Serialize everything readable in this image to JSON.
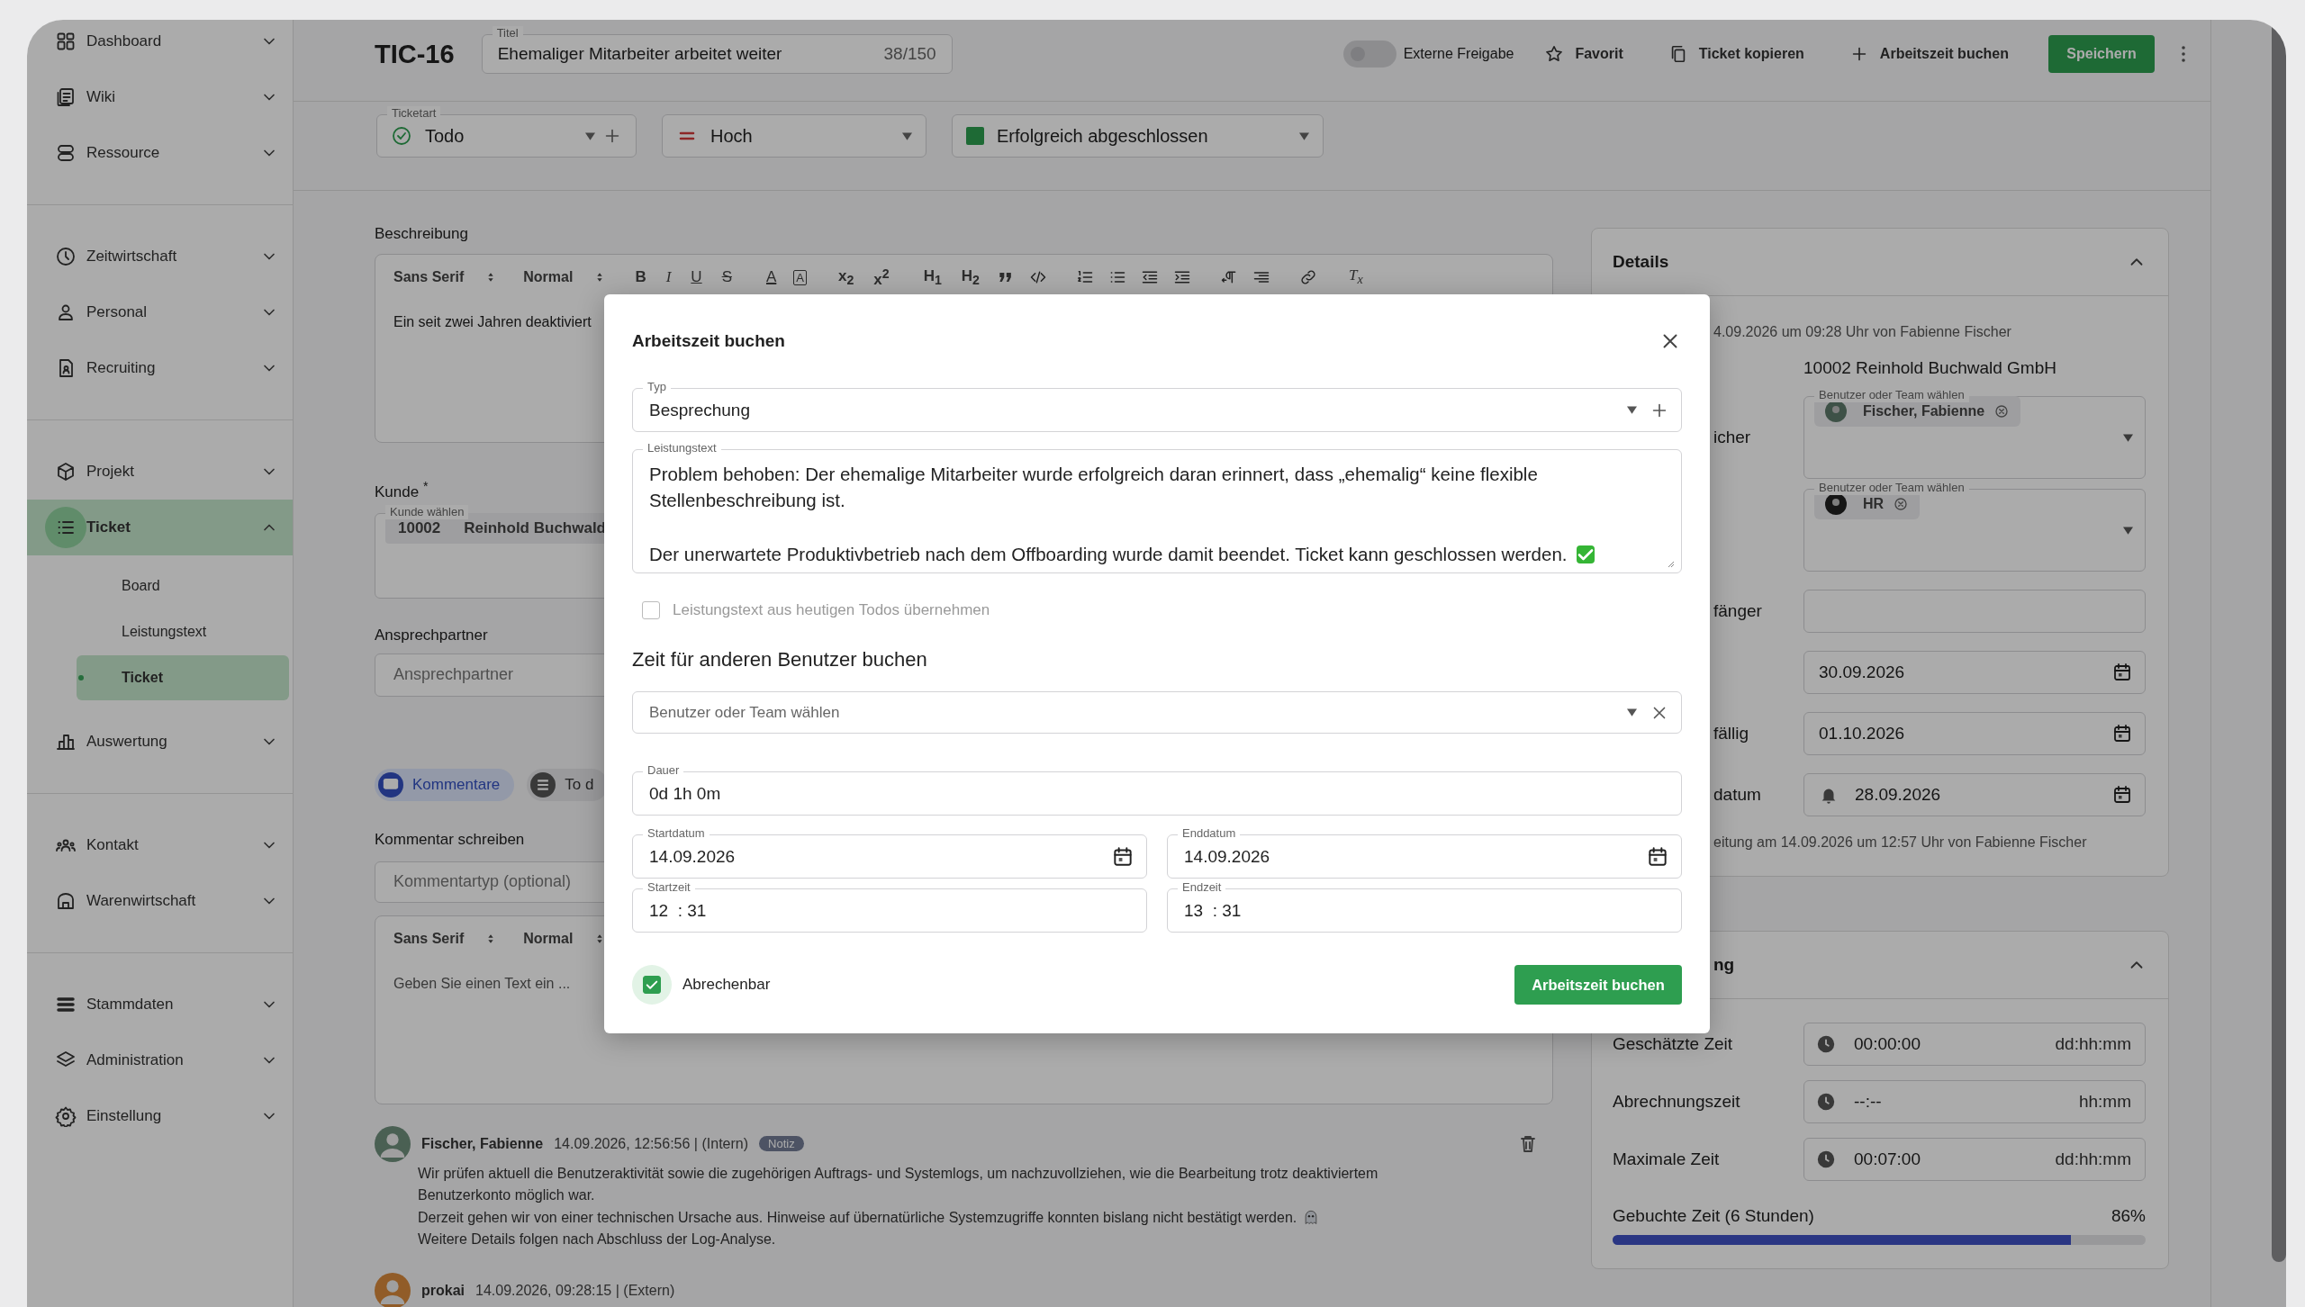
{
  "sidebar": {
    "groups": [
      {
        "items": [
          {
            "label": "Dashboard",
            "selected": false,
            "expanded": false
          },
          {
            "label": "Wiki",
            "selected": false,
            "expanded": false
          },
          {
            "label": "Ressource",
            "selected": false,
            "expanded": false
          }
        ]
      },
      {
        "items": [
          {
            "label": "Zeitwirtschaft",
            "selected": false,
            "expanded": false
          },
          {
            "label": "Personal",
            "selected": false,
            "expanded": false
          },
          {
            "label": "Recruiting",
            "selected": false,
            "expanded": false
          }
        ]
      },
      {
        "items": [
          {
            "label": "Projekt",
            "selected": false,
            "expanded": false
          },
          {
            "label": "Ticket",
            "selected": true,
            "expanded": true,
            "children": [
              {
                "label": "Board",
                "selected": false
              },
              {
                "label": "Leistungstext",
                "selected": false
              },
              {
                "label": "Ticket",
                "selected": true
              }
            ]
          },
          {
            "label": "Auswertung",
            "selected": false,
            "expanded": false
          }
        ]
      },
      {
        "items": [
          {
            "label": "Kontakt",
            "selected": false,
            "expanded": false
          },
          {
            "label": "Warenwirtschaft",
            "selected": false,
            "expanded": false
          }
        ]
      },
      {
        "items": [
          {
            "label": "Stammdaten",
            "selected": false,
            "expanded": false
          },
          {
            "label": "Administration",
            "selected": false,
            "expanded": false
          },
          {
            "label": "Einstellung",
            "selected": false,
            "expanded": false
          }
        ]
      }
    ]
  },
  "header": {
    "ticket_id": "TIC-16",
    "title_field": {
      "label": "Titel",
      "value": "Ehemaliger Mitarbeiter arbeitet weiter",
      "counter": "38/150"
    },
    "toggle": {
      "label": "Externe Freigabe",
      "on": false
    },
    "actions": [
      {
        "label": "Favorit"
      },
      {
        "label": "Ticket kopieren"
      },
      {
        "label": "Arbeitszeit buchen"
      }
    ],
    "save_button": "Speichern"
  },
  "ticket_fields": {
    "type": {
      "label": "Ticketart",
      "value": "Todo"
    },
    "priority": {
      "value": "Hoch"
    },
    "status": {
      "value": "Erfolgreich abgeschlossen"
    }
  },
  "description": {
    "label": "Beschreibung",
    "toolbar": {
      "font": "Sans Serif",
      "size": "Normal",
      "tools": [
        {
          "kind": "bold",
          "label": "B"
        },
        {
          "kind": "italic",
          "label": "I"
        },
        {
          "kind": "underline",
          "label": "U"
        },
        {
          "kind": "strike",
          "label": "S"
        },
        {
          "kind": "color",
          "label": "A"
        },
        {
          "kind": "background",
          "label": "A"
        },
        {
          "kind": "sub",
          "label": "x$_{2}$"
        },
        {
          "kind": "super",
          "label": "x$^{2}$"
        },
        {
          "kind": "h1",
          "label": "H$_{1}$"
        },
        {
          "kind": "h2",
          "label": "H$_{2}$"
        },
        {
          "kind": "quote"
        },
        {
          "kind": "code"
        },
        {
          "kind": "ol"
        },
        {
          "kind": "ul"
        },
        {
          "kind": "outdent"
        },
        {
          "kind": "indent"
        },
        {
          "kind": "rtl"
        },
        {
          "kind": "align"
        },
        {
          "kind": "link"
        },
        {
          "kind": "clean",
          "label": "T$_{x}$"
        }
      ]
    },
    "text": "Ein seit zwei Jahren deaktiviert"
  },
  "customer": {
    "label": "Kunde $^{*}$",
    "field_label": "Kunde wählen",
    "chip_number": "10002",
    "chip_name": "Reinhold Buchwald"
  },
  "contact": {
    "label": "Ansprechpartner",
    "placeholder": "Ansprechpartner"
  },
  "tabs": [
    {
      "label": "Kommentare",
      "selected": true
    },
    {
      "label": "To d",
      "selected": false
    }
  ],
  "comment_form": {
    "heading": "Kommentar schreiben",
    "type_placeholder": "Kommentartyp (optional)",
    "font": "Sans Serif",
    "size": "Normal",
    "placeholder": "Geben Sie einen Text ein ..."
  },
  "comments": [
    {
      "author": "Fischer, Fabienne",
      "meta": "14.09.2026, 12:56:56 | (Intern)",
      "badge": "Notiz",
      "paragraphs": [
        "Wir prüfen aktuell die Benutzeraktivität sowie die zugehörigen Auftrags- und Systemlogs, um nachzuvollziehen, wie die Bearbeitung trotz deaktiviertem Benutzerkonto möglich war.",
        "Derzeit gehen wir von einer technischen Ursache aus. Hinweise auf übernatürliche Systemzugriffe konnten bislang nicht bestätigt werden.",
        "Weitere Details folgen nach Abschluss der Log-Analyse."
      ]
    },
    {
      "author": "prokai",
      "meta": "14.09.2026, 09:28:15 | (Extern)"
    }
  ],
  "details": {
    "title": "Details",
    "expanded": true,
    "rows": [
      {
        "kind": "plain",
        "value": "4.09.2026 um 09:28 Uhr von Fabienne Fischer"
      },
      {
        "kind": "value",
        "value": "10002 Reinhold Buchwald GmbH"
      },
      {
        "kind": "users",
        "label": "icher",
        "field_label": "Benutzer oder Team wählen",
        "chip": "Fischer, Fabienne"
      },
      {
        "kind": "users",
        "field_label": "Benutzer oder Team wählen",
        "chip": "HR"
      },
      {
        "kind": "text",
        "label": "fänger"
      },
      {
        "kind": "date",
        "value": "30.09.2026"
      },
      {
        "kind": "date",
        "label": "fällig",
        "value": "01.10.2026"
      },
      {
        "kind": "reminder",
        "label": "datum",
        "value": "28.09.2026"
      },
      {
        "kind": "plain",
        "value": "eitung am 14.09.2026 um 12:57 Uhr von Fabienne Fischer"
      }
    ]
  },
  "time": {
    "title": "ng",
    "expanded": true,
    "rows": [
      {
        "label": "Geschätzte Zeit",
        "value": "00:00:00",
        "unit": "dd:hh:mm"
      },
      {
        "label": "Abrechnungszeit",
        "value": "--:--",
        "unit": "hh:mm"
      },
      {
        "label": "Maximale Zeit",
        "value": "00:07:00",
        "unit": "dd:hh:mm"
      }
    ],
    "booked": {
      "label": "Gebuchte Zeit (6 Stunden)",
      "percent": "86%",
      "level": 0.86
    }
  },
  "dialog": {
    "title": "Arbeitszeit buchen",
    "type_field": {
      "label": "Typ",
      "value": "Besprechung"
    },
    "text_field": {
      "label": "Leistungstext",
      "paragraphs": [
        "Problem behoben: Der ehemalige Mitarbeiter wurde erfolgreich daran erinnert, dass „ehemalig“ keine flexible Stellenbeschreibung ist.",
        "Der unerwartete Produktivbetrieb nach dem Offboarding wurde damit beendet. Ticket kann geschlossen werden."
      ]
    },
    "todo_checkbox": {
      "label": "Leistungstext aus heutigen Todos übernehmen",
      "checked": false,
      "disabled": true
    },
    "other_user": {
      "heading": "Zeit für anderen Benutzer buchen",
      "placeholder": "Benutzer oder Team wählen"
    },
    "duration": {
      "label": "Dauer",
      "value": "0d 1h 0m"
    },
    "start_date": {
      "label": "Startdatum",
      "value": "14.09.2026"
    },
    "end_date": {
      "label": "Enddatum",
      "value": "14.09.2026"
    },
    "start_time": {
      "label": "Startzeit",
      "value": "12  : 31"
    },
    "end_time": {
      "label": "Endzeit",
      "value": "13  : 31"
    },
    "billable": {
      "label": "Abrechenbar",
      "checked": true
    },
    "submit": "Arbeitszeit buchen"
  }
}
